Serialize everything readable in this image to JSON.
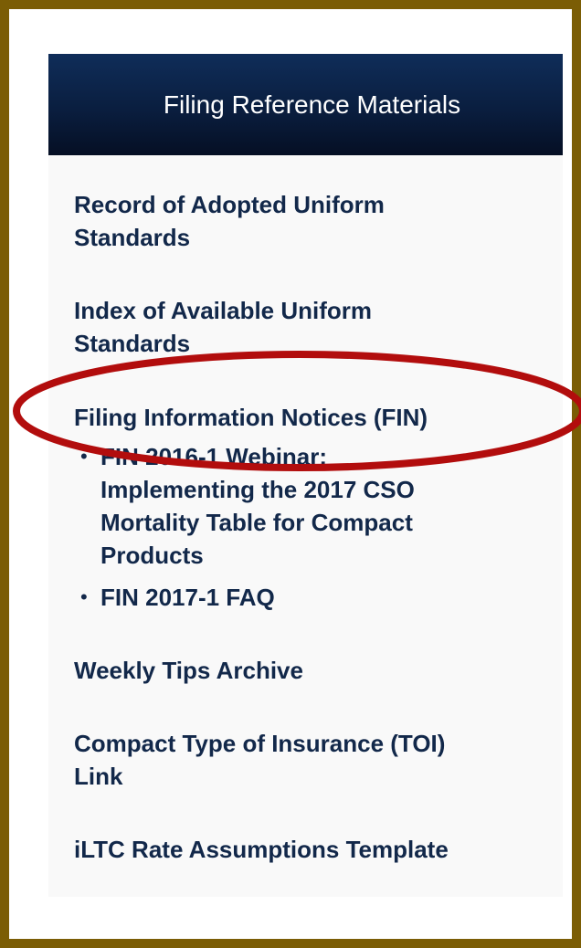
{
  "panel": {
    "title": "Filing Reference Materials"
  },
  "links": [
    {
      "label_line1": "Record of Adopted Uniform",
      "label_line2": "Standards"
    },
    {
      "label_line1": "Index of Available Uniform",
      "label_line2": "Standards"
    },
    {
      "label_line1": "Filing Information Notices (FIN)"
    },
    {
      "label_line1": "Weekly Tips Archive"
    },
    {
      "label_line1": "Compact Type of Insurance (TOI)",
      "label_line2": "Link"
    },
    {
      "label_line1": "iLTC Rate Assumptions Template"
    }
  ],
  "fin_sublinks": [
    {
      "line1": "FIN 2016-1 Webinar:",
      "line2": "Implementing the 2017 CSO",
      "line3": "Mortality Table for Compact",
      "line4": "Products"
    },
    {
      "line1": "FIN 2017-1 FAQ"
    }
  ],
  "colors": {
    "frame_border": "#7b5d05",
    "header_bg": "#0a1e3f",
    "link_text": "#12284a",
    "highlight_oval": "#b20d0d"
  }
}
